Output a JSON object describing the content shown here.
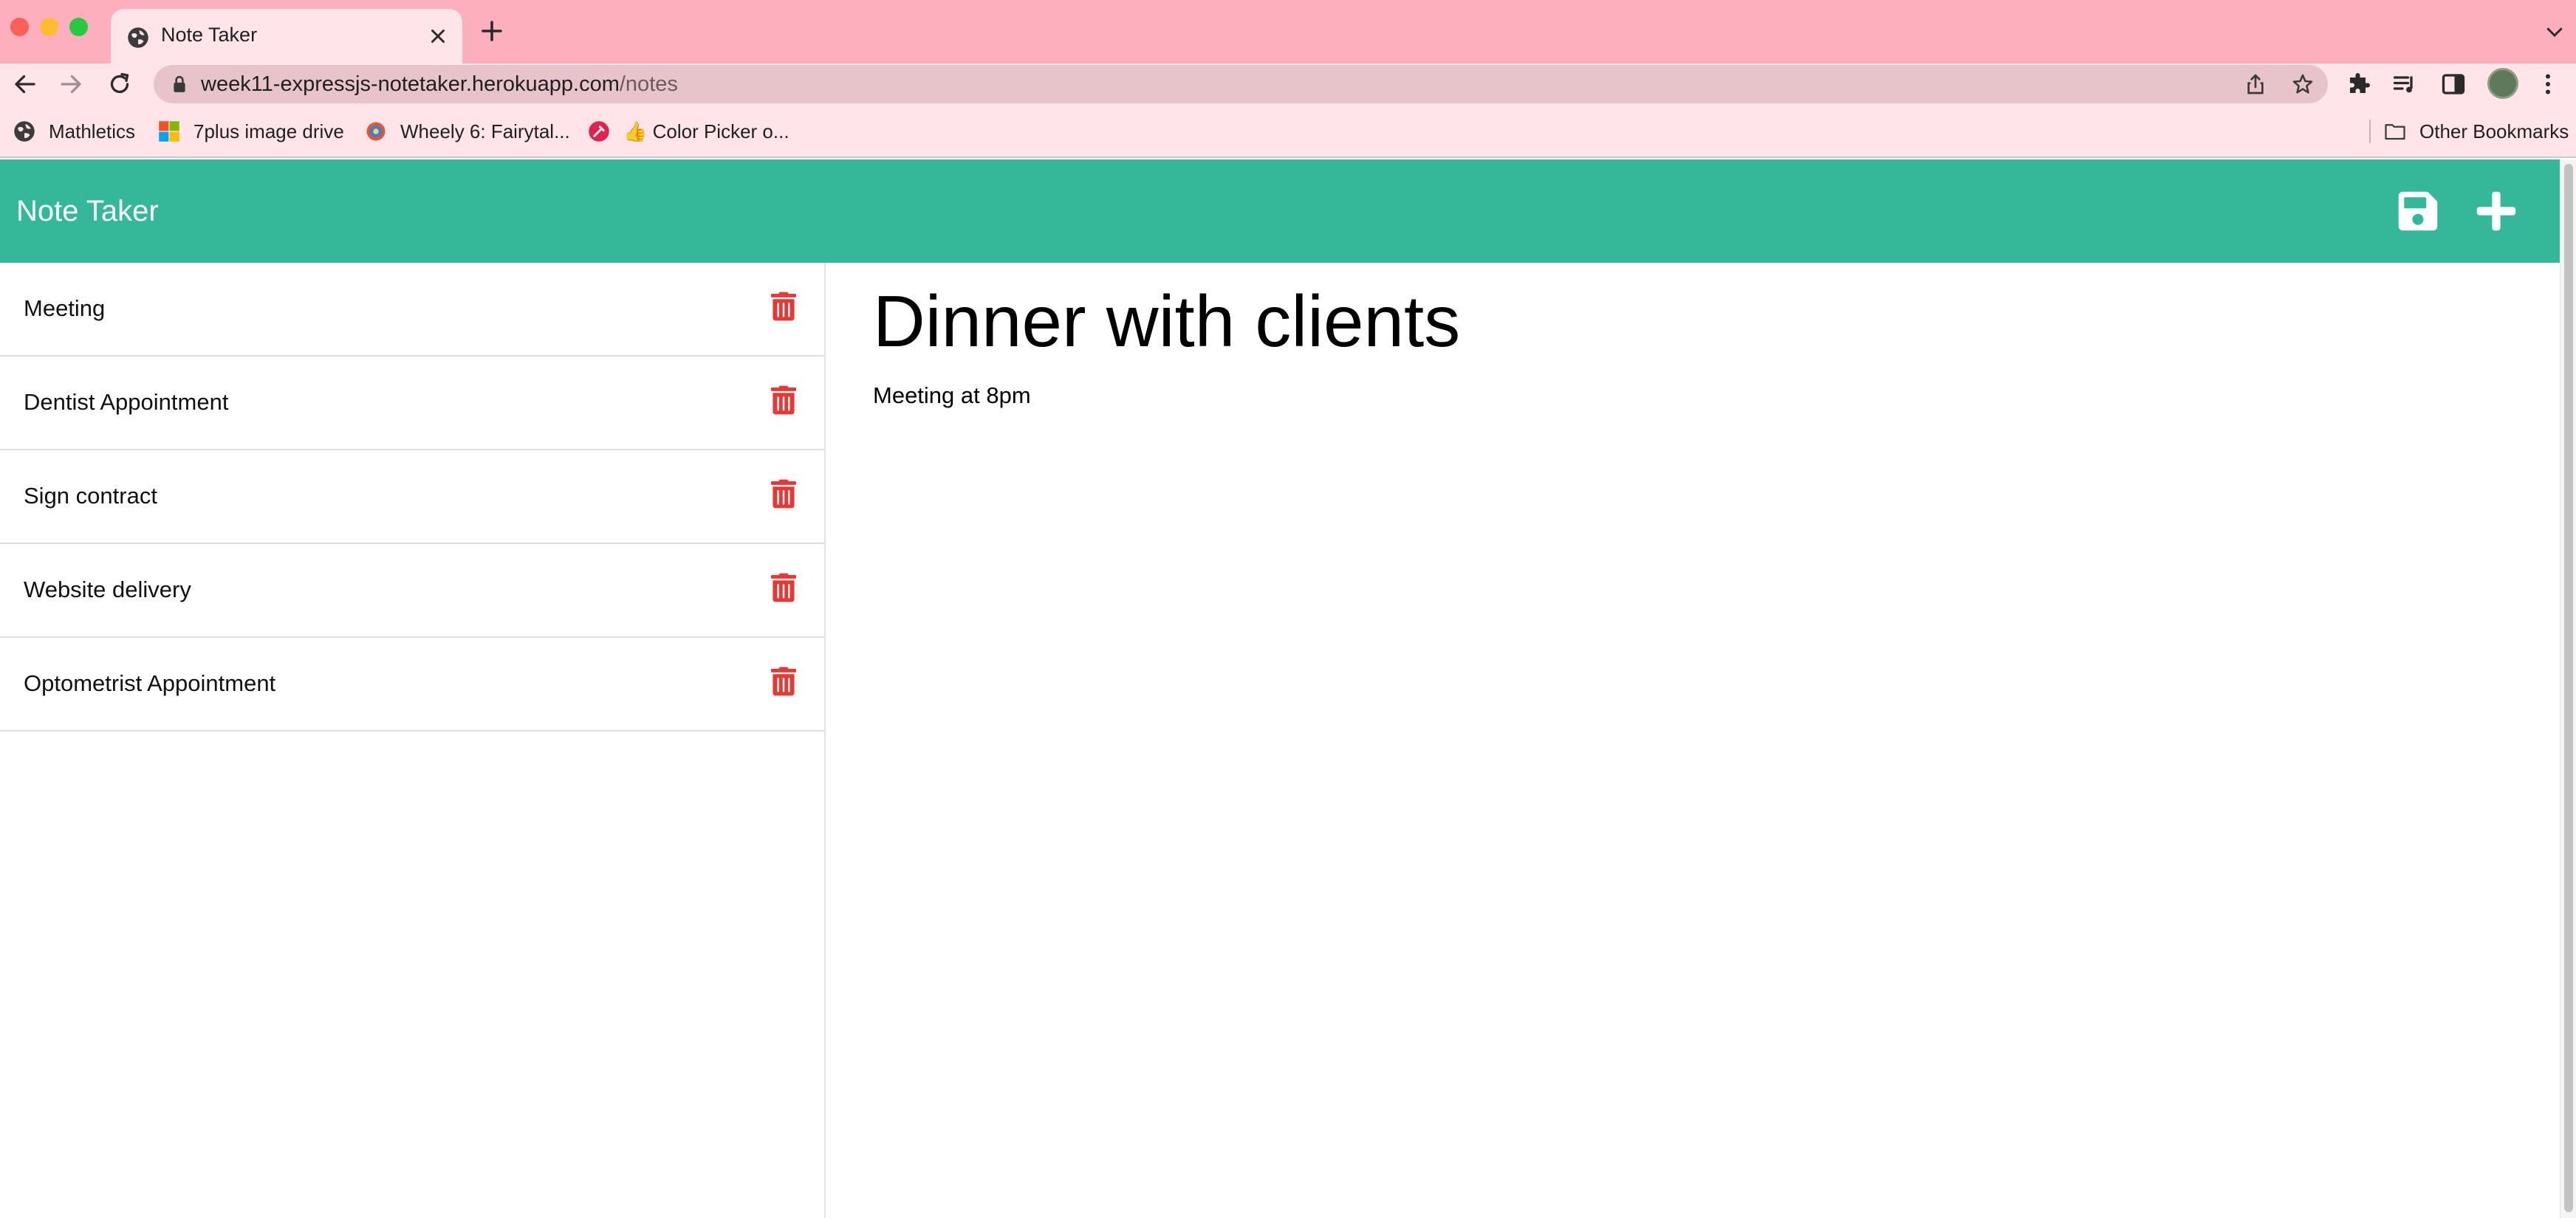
{
  "browser": {
    "tab": {
      "title": "Note Taker",
      "favicon": "globe-icon"
    },
    "address": {
      "domain": "week11-expressjs-notetaker.herokuapp.com",
      "path": "/notes"
    },
    "bookmarks": [
      {
        "label": "Mathletics",
        "icon": "globe-icon"
      },
      {
        "label": "7plus image drive",
        "icon": "windows-logo-icon"
      },
      {
        "label": "Wheely 6: Fairytal...",
        "icon": "target-icon"
      },
      {
        "label": "👍 Color Picker o...",
        "icon": "color-picker-icon"
      }
    ],
    "other_bookmarks": "Other Bookmarks"
  },
  "app": {
    "brand": "Note Taker",
    "accent_color": "#34b899",
    "delete_color": "#e53935",
    "notes": [
      {
        "title": "Meeting"
      },
      {
        "title": "Dentist Appointment"
      },
      {
        "title": "Sign contract"
      },
      {
        "title": "Website delivery"
      },
      {
        "title": "Optometrist Appointment"
      }
    ],
    "active_note": {
      "title": "Dinner with clients",
      "text": "Meeting at 8pm"
    }
  }
}
